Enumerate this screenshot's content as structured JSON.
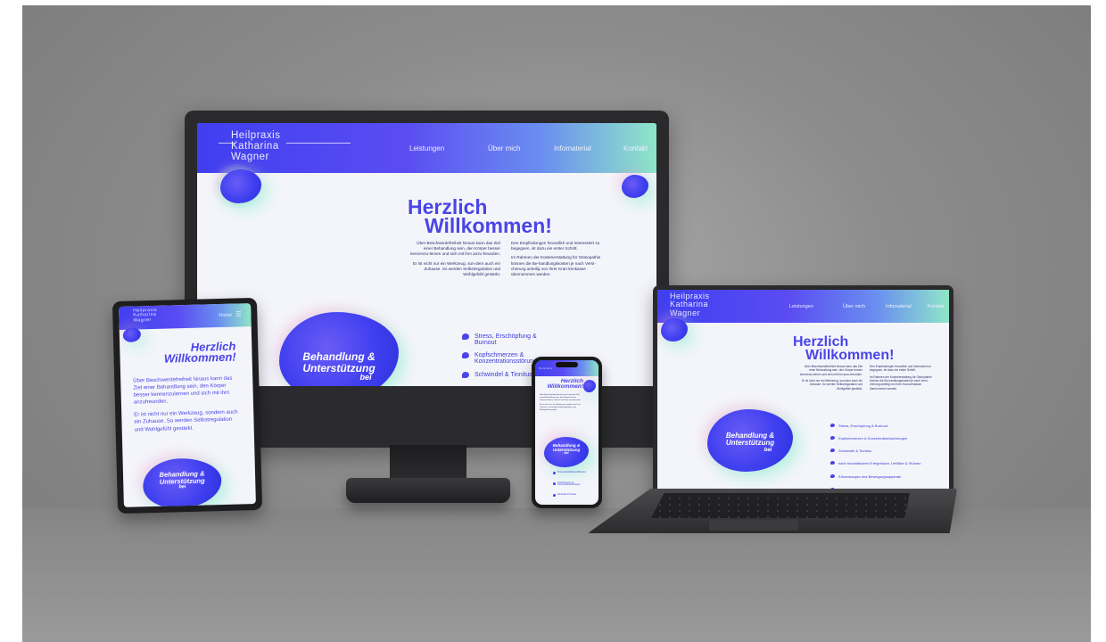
{
  "brand": {
    "line1": "Heilpraxis",
    "line2": "Katharina",
    "line3": "Wagner"
  },
  "nav": [
    "Leistungen",
    "Über mich",
    "Infomaterial",
    "Kontakt"
  ],
  "tablet_nav": {
    "home": "Home",
    "menu_icon": "hamburger-icon"
  },
  "hero": {
    "line1": "Herzlich",
    "line2": "Willkommen!"
  },
  "intro": {
    "left_1": "Über Beschwerdefreiheit hinaus kann das Ziel einer Behandlung sein, den Körper besser kennenzu-lernen und sich mit ihm anzu-freunden.",
    "left_2": "Er ist nicht nur ein Werkzeug, son-dern auch ein Zuhause. So werden Selbstregulation und Wohlgefühl gestärkt.",
    "right_1": "Den Empfindungen freundlich und interessiert zu begegnen, ist dazu ein erster Schritt.",
    "right_2": "Im Rahmen der Kostenerstattung für Osteopathie können die Be-handlungskosten je nach Versi-cherung anteilig von Ihrer Kran-kenkasse übernommen werden."
  },
  "tablet_text": {
    "p1": "Über Beschwerdefreiheit hinaus kann das Ziel einer Behandlung sein, den Körper besser kennenzulernen und sich mit ihm anzufreunden.",
    "p2": "Er ist nicht nur ein Werkzeug, sondern auch ein Zuhause. So werden Selbstregulation und Wohlgefühl gestärkt."
  },
  "blob": {
    "line1": "Behandlung &",
    "line2": "Unterstützung",
    "line3": "bei"
  },
  "list": [
    "Stress, Erschöpfung & Burnout",
    "Kopfschmerzen & Konzentrationsstörungen",
    "Schwindel & Tinnitus",
    "nach traumatischen Ereignissen, Unfällen & Stürzen",
    "Erkrankungen des Bewegungsapparats",
    "Bewegungseinschränkungen,"
  ],
  "colors": {
    "accent": "#4a45e6",
    "header_start": "#3f3ff0",
    "header_end": "#8fe6c8",
    "text": "#2c2c66"
  }
}
